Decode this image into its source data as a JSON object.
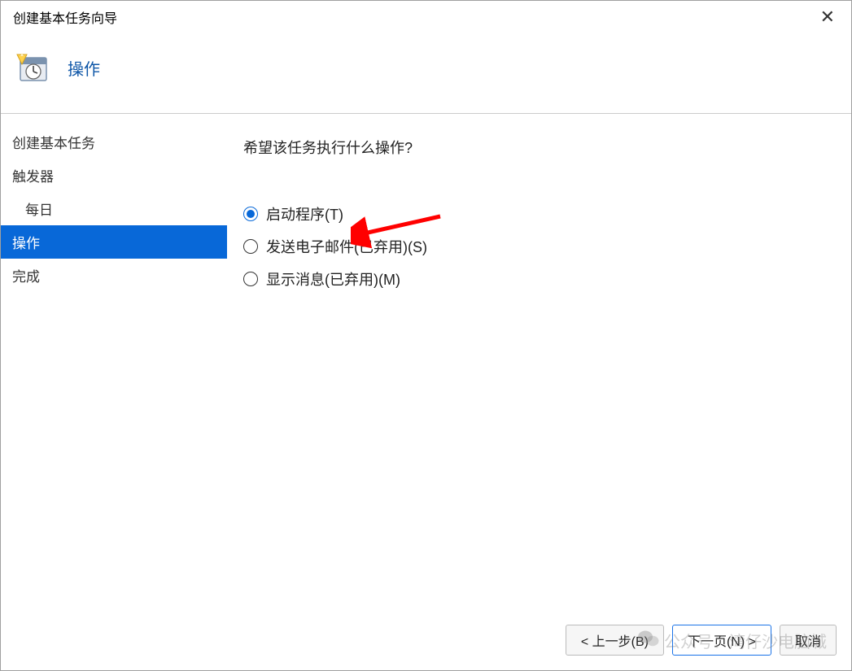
{
  "window": {
    "title": "创建基本任务向导"
  },
  "header": {
    "title": "操作"
  },
  "sidebar": {
    "items": [
      {
        "label": "创建基本任务",
        "selected": false,
        "indent": false
      },
      {
        "label": "触发器",
        "selected": false,
        "indent": false
      },
      {
        "label": "每日",
        "selected": false,
        "indent": true
      },
      {
        "label": "操作",
        "selected": true,
        "indent": false
      },
      {
        "label": "完成",
        "selected": false,
        "indent": false
      }
    ]
  },
  "main": {
    "question": "希望该任务执行什么操作?",
    "options": [
      {
        "label": "启动程序(T)",
        "selected": true
      },
      {
        "label": "发送电子邮件(已弃用)(S)",
        "selected": false
      },
      {
        "label": "显示消息(已弃用)(M)",
        "selected": false
      }
    ]
  },
  "footer": {
    "back_label": "< 上一步(B)",
    "next_label": "下一页(N) >",
    "cancel_label": "取消"
  },
  "watermark": {
    "text": "公众号：湾仔沙电脑城"
  }
}
